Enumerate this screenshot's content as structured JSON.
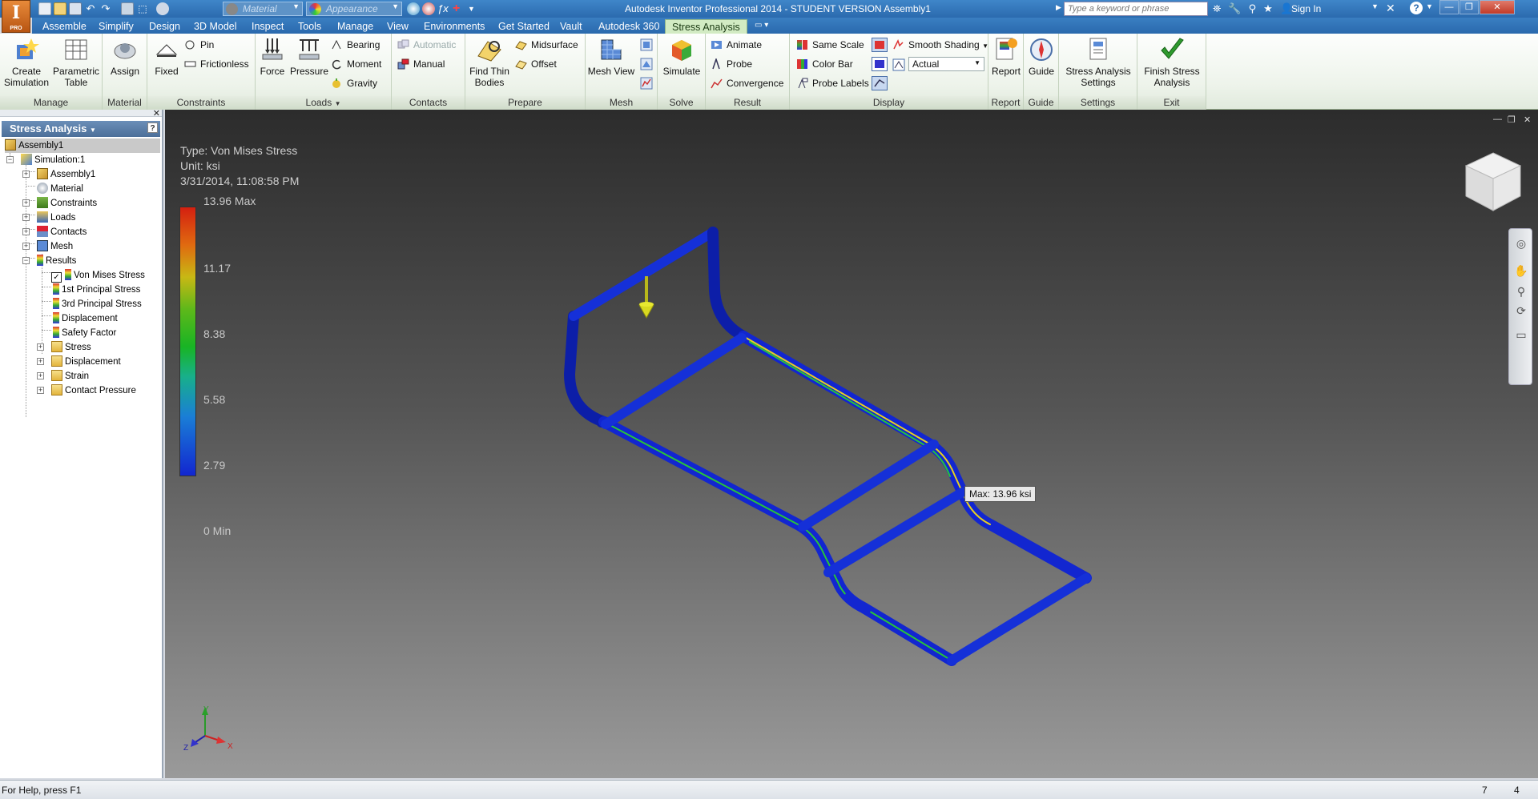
{
  "titlebar": {
    "app_title": "Autodesk Inventor Professional 2014 - STUDENT VERSION   Assembly1",
    "material_combo": "Material",
    "appearance_combo": "Appearance",
    "search_placeholder": "Type a keyword or phrase",
    "sign_in": "Sign In",
    "logo_letter": "I",
    "logo_sub": "PRO"
  },
  "menu_tabs": [
    "Assemble",
    "Simplify",
    "Design",
    "3D Model",
    "Inspect",
    "Tools",
    "Manage",
    "View",
    "Environments",
    "Get Started",
    "Vault",
    "Autodesk 360",
    "Stress Analysis"
  ],
  "ribbon": {
    "manage": {
      "label": "Manage",
      "create_simulation": "Create Simulation",
      "parametric_table": "Parametric Table"
    },
    "material": {
      "label": "Material",
      "assign": "Assign"
    },
    "constraints": {
      "label": "Constraints",
      "fixed": "Fixed",
      "pin": "Pin",
      "frictionless": "Frictionless"
    },
    "loads": {
      "label": "Loads",
      "force": "Force",
      "pressure": "Pressure",
      "bearing": "Bearing",
      "moment": "Moment",
      "gravity": "Gravity"
    },
    "contacts": {
      "label": "Contacts",
      "automatic": "Automatic",
      "manual": "Manual"
    },
    "prepare": {
      "label": "Prepare",
      "find_thin_bodies": "Find Thin Bodies",
      "midsurface": "Midsurface",
      "offset": "Offset"
    },
    "mesh": {
      "label": "Mesh",
      "mesh_view": "Mesh View"
    },
    "solve": {
      "label": "Solve",
      "simulate": "Simulate"
    },
    "result": {
      "label": "Result",
      "animate": "Animate",
      "probe": "Probe",
      "convergence": "Convergence"
    },
    "display": {
      "label": "Display",
      "same_scale": "Same Scale",
      "color_bar": "Color Bar",
      "probe_labels": "Probe Labels",
      "shading": "Smooth Shading",
      "displacement_select": "Actual"
    },
    "report": {
      "label": "Report",
      "report": "Report"
    },
    "guide": {
      "label": "Guide",
      "guide": "Guide"
    },
    "settings": {
      "label": "Settings",
      "settings": "Stress Analysis Settings"
    },
    "exit": {
      "label": "Exit",
      "finish": "Finish Stress Analysis"
    }
  },
  "browser": {
    "title": "Stress Analysis",
    "nodes": {
      "assembly": "Assembly1",
      "simulation": "Simulation:1",
      "sim_assembly": "Assembly1",
      "material": "Material",
      "constraints": "Constraints",
      "loads": "Loads",
      "contacts": "Contacts",
      "mesh": "Mesh",
      "results": "Results",
      "von_mises": "Von Mises Stress",
      "principal1": "1st Principal Stress",
      "principal3": "3rd Principal Stress",
      "displacement": "Displacement",
      "safety": "Safety Factor",
      "stress": "Stress",
      "displacement2": "Displacement",
      "strain": "Strain",
      "contact_pressure": "Contact Pressure"
    }
  },
  "viewport": {
    "type_line": "Type: Von Mises Stress",
    "unit_line": "Unit: ksi",
    "date_line": "3/31/2014, 11:08:58 PM",
    "legend": [
      "13.96 Max",
      "11.17",
      "8.38",
      "5.58",
      "2.79",
      "0 Min"
    ],
    "max_tooltip": "Max: 13.96 ksi",
    "axes": {
      "x": "X",
      "y": "Y",
      "z": "Z"
    }
  },
  "status": {
    "help": "For Help, press F1",
    "count_a": "7",
    "count_b": "4"
  },
  "colors": {
    "accent_green": "#d2ebc3",
    "title_blue": "#2b6aae",
    "stress_max": "#d42010",
    "stress_min": "#1226d0"
  }
}
